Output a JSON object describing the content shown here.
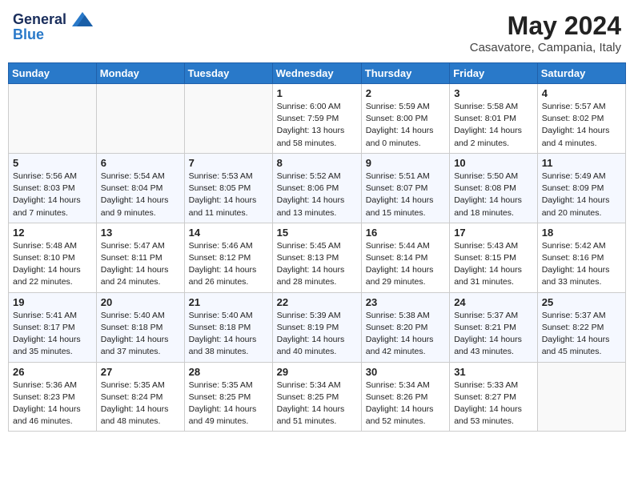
{
  "header": {
    "logo_line1": "General",
    "logo_line2": "Blue",
    "month_year": "May 2024",
    "location": "Casavatore, Campania, Italy"
  },
  "weekdays": [
    "Sunday",
    "Monday",
    "Tuesday",
    "Wednesday",
    "Thursday",
    "Friday",
    "Saturday"
  ],
  "weeks": [
    [
      {
        "day": "",
        "info": ""
      },
      {
        "day": "",
        "info": ""
      },
      {
        "day": "",
        "info": ""
      },
      {
        "day": "1",
        "info": "Sunrise: 6:00 AM\nSunset: 7:59 PM\nDaylight: 13 hours\nand 58 minutes."
      },
      {
        "day": "2",
        "info": "Sunrise: 5:59 AM\nSunset: 8:00 PM\nDaylight: 14 hours\nand 0 minutes."
      },
      {
        "day": "3",
        "info": "Sunrise: 5:58 AM\nSunset: 8:01 PM\nDaylight: 14 hours\nand 2 minutes."
      },
      {
        "day": "4",
        "info": "Sunrise: 5:57 AM\nSunset: 8:02 PM\nDaylight: 14 hours\nand 4 minutes."
      }
    ],
    [
      {
        "day": "5",
        "info": "Sunrise: 5:56 AM\nSunset: 8:03 PM\nDaylight: 14 hours\nand 7 minutes."
      },
      {
        "day": "6",
        "info": "Sunrise: 5:54 AM\nSunset: 8:04 PM\nDaylight: 14 hours\nand 9 minutes."
      },
      {
        "day": "7",
        "info": "Sunrise: 5:53 AM\nSunset: 8:05 PM\nDaylight: 14 hours\nand 11 minutes."
      },
      {
        "day": "8",
        "info": "Sunrise: 5:52 AM\nSunset: 8:06 PM\nDaylight: 14 hours\nand 13 minutes."
      },
      {
        "day": "9",
        "info": "Sunrise: 5:51 AM\nSunset: 8:07 PM\nDaylight: 14 hours\nand 15 minutes."
      },
      {
        "day": "10",
        "info": "Sunrise: 5:50 AM\nSunset: 8:08 PM\nDaylight: 14 hours\nand 18 minutes."
      },
      {
        "day": "11",
        "info": "Sunrise: 5:49 AM\nSunset: 8:09 PM\nDaylight: 14 hours\nand 20 minutes."
      }
    ],
    [
      {
        "day": "12",
        "info": "Sunrise: 5:48 AM\nSunset: 8:10 PM\nDaylight: 14 hours\nand 22 minutes."
      },
      {
        "day": "13",
        "info": "Sunrise: 5:47 AM\nSunset: 8:11 PM\nDaylight: 14 hours\nand 24 minutes."
      },
      {
        "day": "14",
        "info": "Sunrise: 5:46 AM\nSunset: 8:12 PM\nDaylight: 14 hours\nand 26 minutes."
      },
      {
        "day": "15",
        "info": "Sunrise: 5:45 AM\nSunset: 8:13 PM\nDaylight: 14 hours\nand 28 minutes."
      },
      {
        "day": "16",
        "info": "Sunrise: 5:44 AM\nSunset: 8:14 PM\nDaylight: 14 hours\nand 29 minutes."
      },
      {
        "day": "17",
        "info": "Sunrise: 5:43 AM\nSunset: 8:15 PM\nDaylight: 14 hours\nand 31 minutes."
      },
      {
        "day": "18",
        "info": "Sunrise: 5:42 AM\nSunset: 8:16 PM\nDaylight: 14 hours\nand 33 minutes."
      }
    ],
    [
      {
        "day": "19",
        "info": "Sunrise: 5:41 AM\nSunset: 8:17 PM\nDaylight: 14 hours\nand 35 minutes."
      },
      {
        "day": "20",
        "info": "Sunrise: 5:40 AM\nSunset: 8:18 PM\nDaylight: 14 hours\nand 37 minutes."
      },
      {
        "day": "21",
        "info": "Sunrise: 5:40 AM\nSunset: 8:18 PM\nDaylight: 14 hours\nand 38 minutes."
      },
      {
        "day": "22",
        "info": "Sunrise: 5:39 AM\nSunset: 8:19 PM\nDaylight: 14 hours\nand 40 minutes."
      },
      {
        "day": "23",
        "info": "Sunrise: 5:38 AM\nSunset: 8:20 PM\nDaylight: 14 hours\nand 42 minutes."
      },
      {
        "day": "24",
        "info": "Sunrise: 5:37 AM\nSunset: 8:21 PM\nDaylight: 14 hours\nand 43 minutes."
      },
      {
        "day": "25",
        "info": "Sunrise: 5:37 AM\nSunset: 8:22 PM\nDaylight: 14 hours\nand 45 minutes."
      }
    ],
    [
      {
        "day": "26",
        "info": "Sunrise: 5:36 AM\nSunset: 8:23 PM\nDaylight: 14 hours\nand 46 minutes."
      },
      {
        "day": "27",
        "info": "Sunrise: 5:35 AM\nSunset: 8:24 PM\nDaylight: 14 hours\nand 48 minutes."
      },
      {
        "day": "28",
        "info": "Sunrise: 5:35 AM\nSunset: 8:25 PM\nDaylight: 14 hours\nand 49 minutes."
      },
      {
        "day": "29",
        "info": "Sunrise: 5:34 AM\nSunset: 8:25 PM\nDaylight: 14 hours\nand 51 minutes."
      },
      {
        "day": "30",
        "info": "Sunrise: 5:34 AM\nSunset: 8:26 PM\nDaylight: 14 hours\nand 52 minutes."
      },
      {
        "day": "31",
        "info": "Sunrise: 5:33 AM\nSunset: 8:27 PM\nDaylight: 14 hours\nand 53 minutes."
      },
      {
        "day": "",
        "info": ""
      }
    ]
  ]
}
